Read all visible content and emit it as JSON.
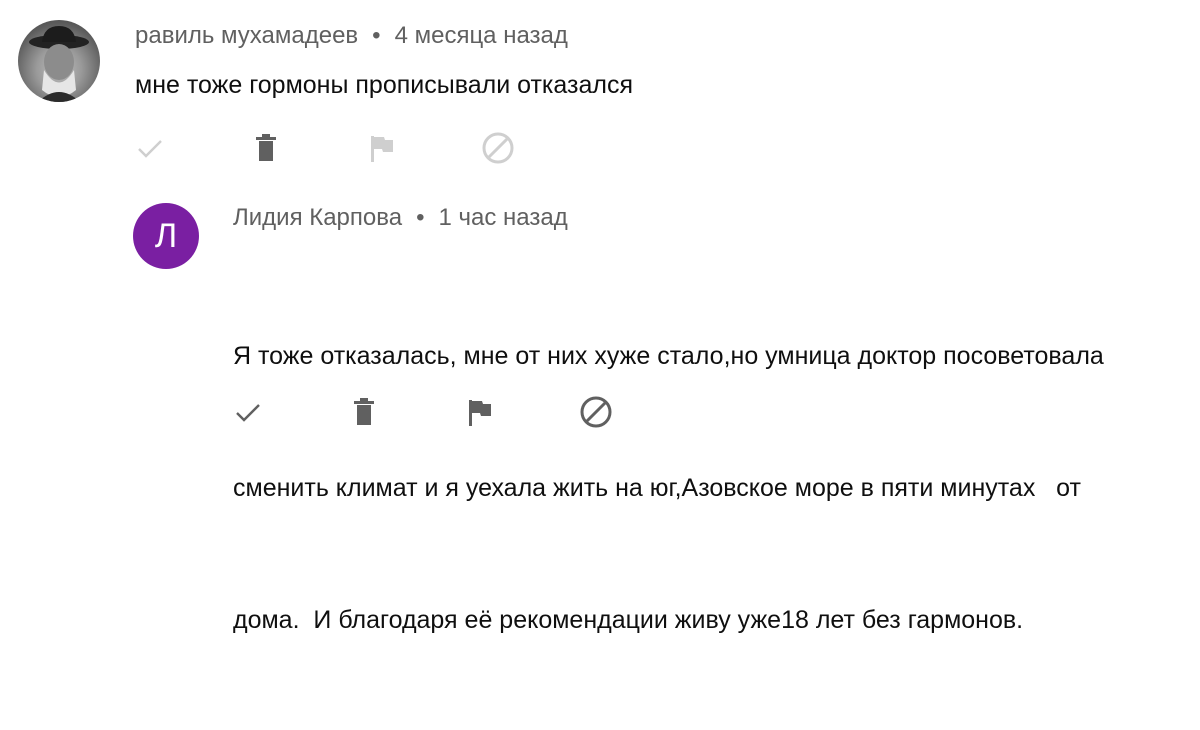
{
  "comments": [
    {
      "author": "равиль мухамадеев",
      "separator": "•",
      "time": "4 месяца назад",
      "avatar_type": "photo",
      "text": "мне тоже гормоны прописывали отказался",
      "actions": [
        "check-icon",
        "trash-icon",
        "flag-icon",
        "block-icon"
      ],
      "action_color": "#cfcfcf"
    },
    {
      "author": "Лидия Карпова",
      "separator": "•",
      "time": "1 час назад",
      "avatar_type": "letter",
      "avatar_letter": "Л",
      "avatar_color": "#7a1fa2",
      "text_lines": [
        "Я тоже отказалась, мне от них хуже стало,но умница доктор посоветовала",
        "сменить климат и я уехала жить на юг,Азовское море в пяти минутах   от",
        "дома.  И благодаря её рекомендации живу уже18 лет без гармонов."
      ],
      "actions": [
        "check-icon",
        "trash-icon",
        "flag-icon",
        "block-icon"
      ],
      "action_color": "#606060"
    }
  ]
}
